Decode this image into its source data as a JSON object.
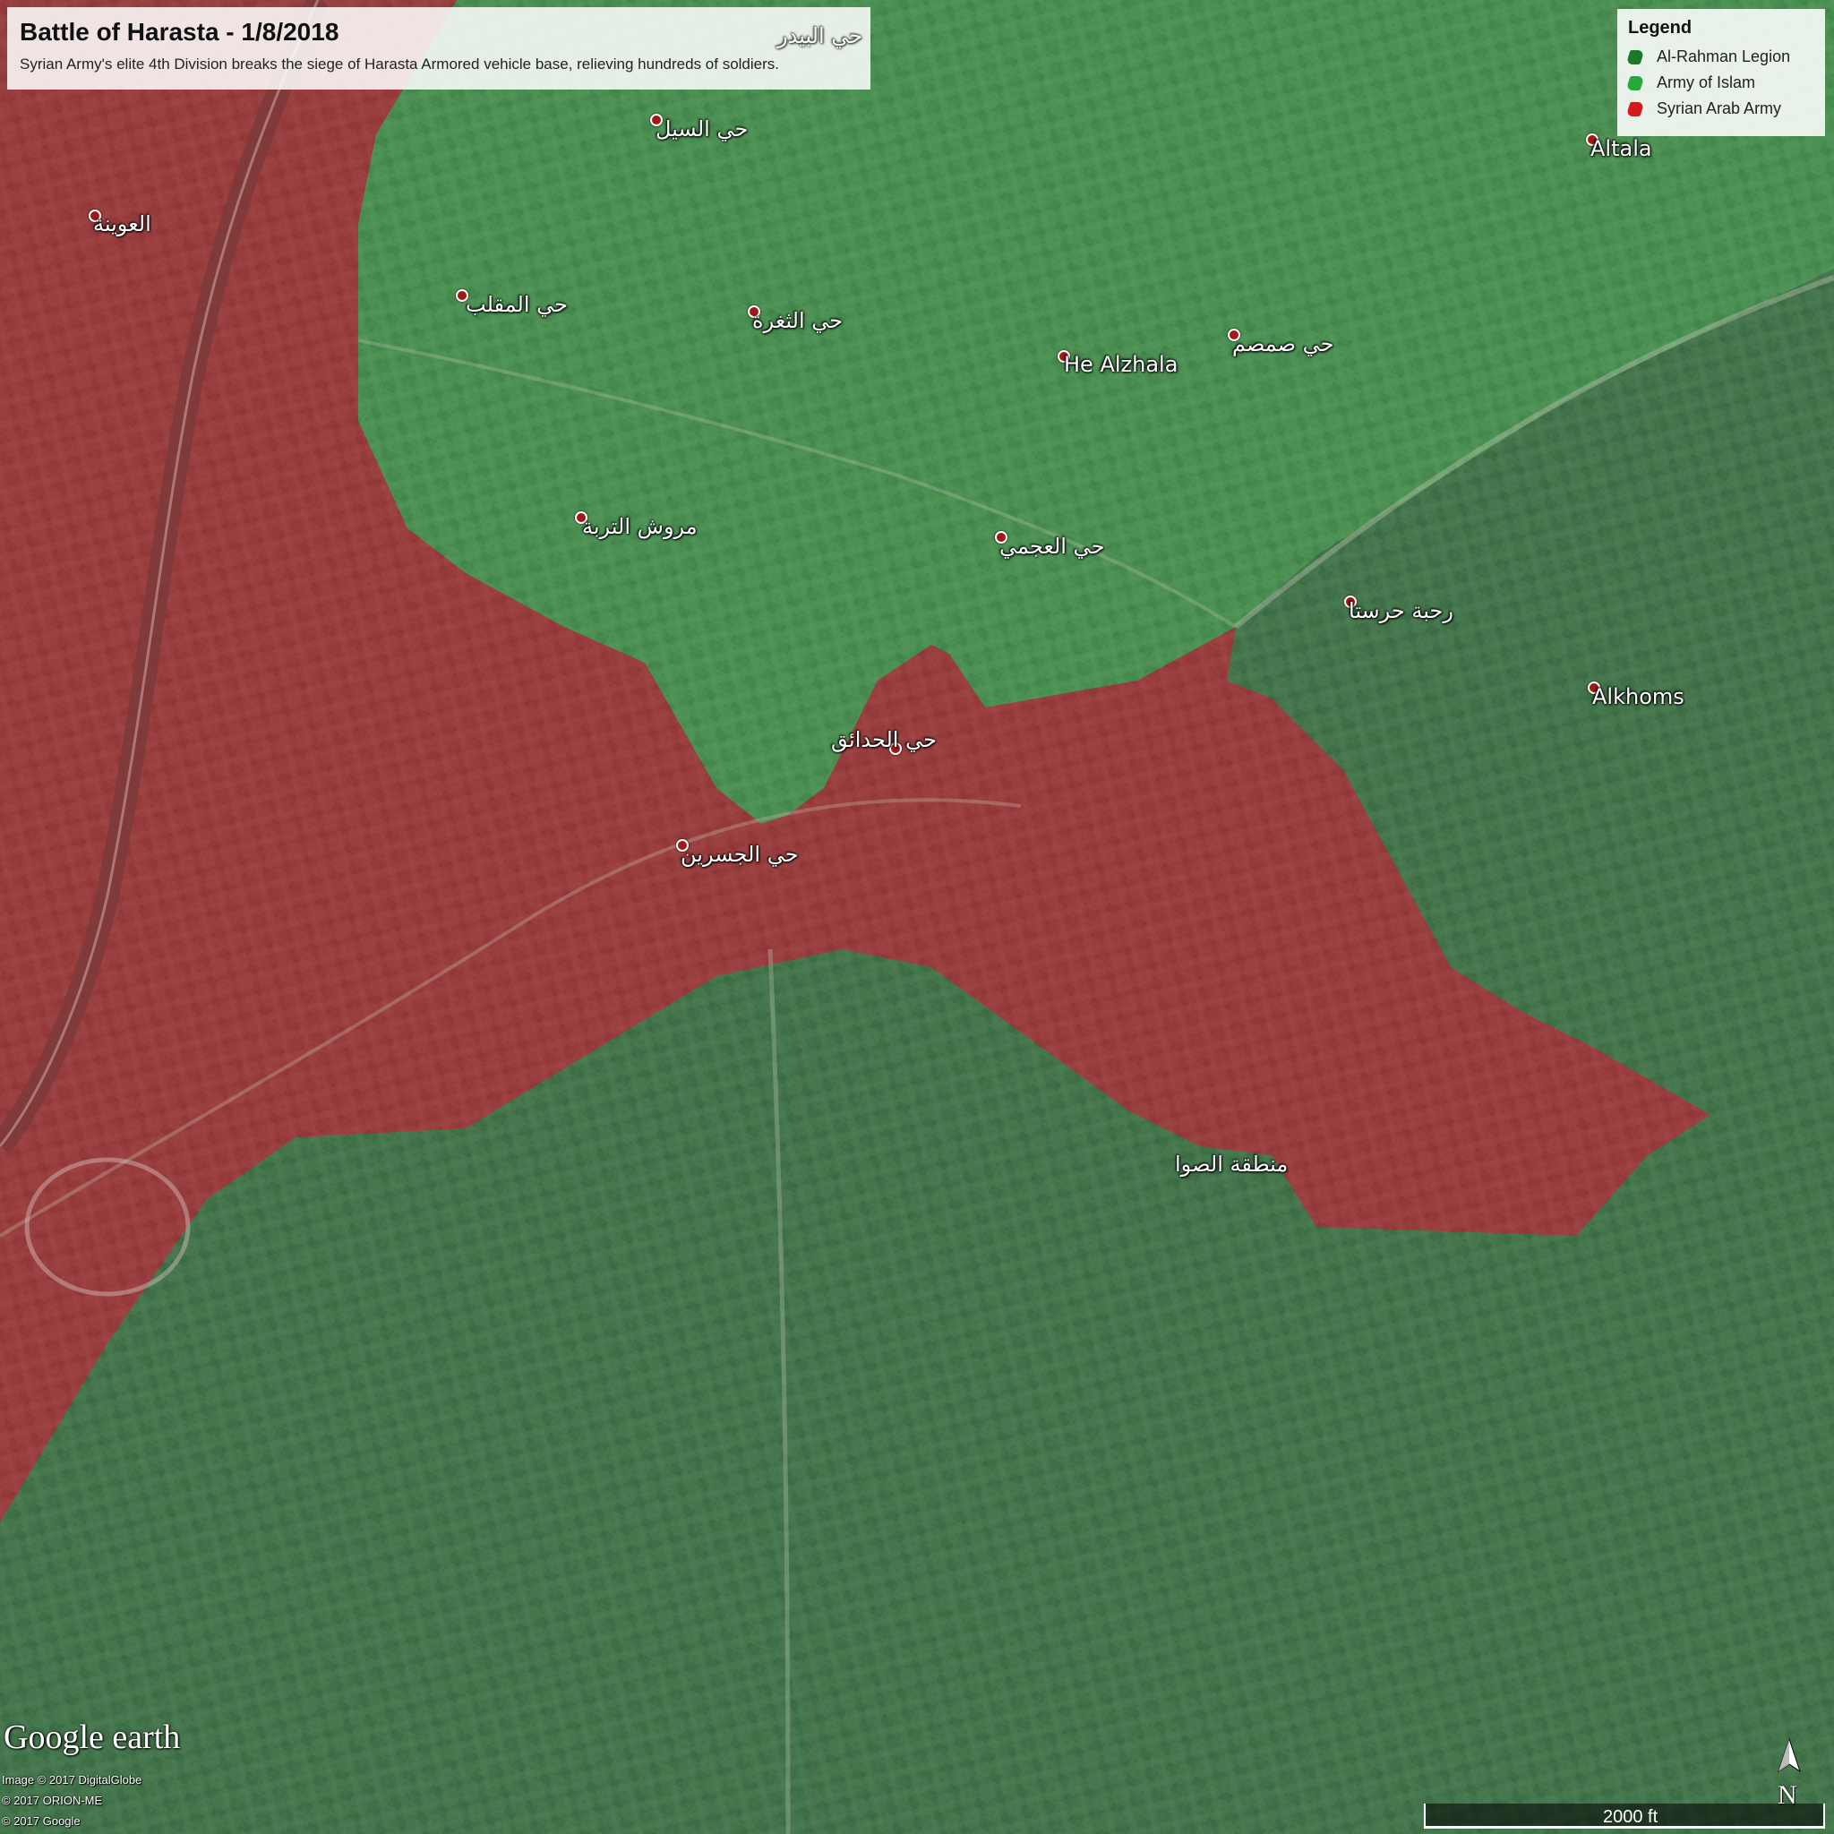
{
  "header": {
    "title": "Battle of Harasta - 1/8/2018",
    "subtitle": "Syrian Army's elite 4th Division breaks the siege of Harasta Armored vehicle base, relieving hundreds of soldiers."
  },
  "legend": {
    "title": "Legend",
    "items": [
      {
        "label": "Al-Rahman Legion",
        "color": "#1a7a2a"
      },
      {
        "label": "Army of Islam",
        "color": "#28a83a"
      },
      {
        "label": "Syrian Arab Army",
        "color": "#d41a1a"
      }
    ]
  },
  "zone_colors": {
    "syrian_arab_army": "#b02a33",
    "army_of_islam": "#3aa450",
    "al_rahman_legion": "#2f7a45"
  },
  "places": {
    "al_bayder": "حي البيدر",
    "al_sayl": "حي السيل",
    "al_awina": "العوينة",
    "al_maqlab": "حي المقلب",
    "al_thaghra": "حي الثغرة",
    "he_alzhala": "He Alzhala",
    "samsam": "حي صمصم",
    "altala": "Altala",
    "mrouj_al_turba": "مروش التربة",
    "al_ajami": "حي العجمي",
    "rahba_harasta": "رحبة حرستا",
    "alkhoms": "Alkhoms",
    "al_hadaiq": "حي الحدائق",
    "al_jisrayn": "حي الجسرين",
    "mintaqat_al_sawwa": "منطقة الصوا"
  },
  "footer": {
    "logo": "Google earth",
    "credit_1": "Image © 2017 DigitalGlobe",
    "credit_2": "© 2017 ORION-ME",
    "credit_3": "© 2017 Google",
    "north": "N",
    "scale": "2000 ft"
  }
}
